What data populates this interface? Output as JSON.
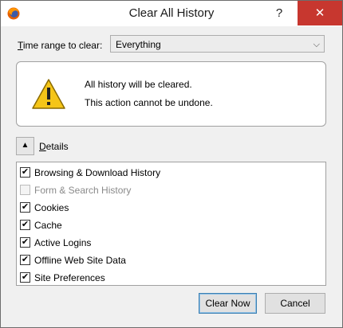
{
  "window": {
    "title": "Clear All History",
    "help_label": "?",
    "close_label": "✕"
  },
  "time_range": {
    "label_accel": "T",
    "label_rest": "ime range to clear:",
    "selected": "Everything"
  },
  "warning": {
    "line1": "All history will be cleared.",
    "line2": "This action cannot be undone."
  },
  "details": {
    "label_accel": "D",
    "label_rest": "etails"
  },
  "items": [
    {
      "label": "Browsing & Download History",
      "checked": true,
      "enabled": true
    },
    {
      "label": "Form & Search History",
      "checked": false,
      "enabled": false
    },
    {
      "label": "Cookies",
      "checked": true,
      "enabled": true
    },
    {
      "label": "Cache",
      "checked": true,
      "enabled": true
    },
    {
      "label": "Active Logins",
      "checked": true,
      "enabled": true
    },
    {
      "label": "Offline Web Site Data",
      "checked": true,
      "enabled": true
    },
    {
      "label": "Site Preferences",
      "checked": true,
      "enabled": true
    }
  ],
  "buttons": {
    "clear_now": "Clear Now",
    "cancel": "Cancel"
  },
  "colors": {
    "close_button": "#c7372f",
    "warning_fill": "#f5c518",
    "default_button_border": "#3c7fb1"
  },
  "icons": {
    "app": "firefox-icon",
    "warning": "warning-triangle-icon",
    "toggle": "caret-up-icon",
    "dropdown": "chevron-down-icon"
  }
}
